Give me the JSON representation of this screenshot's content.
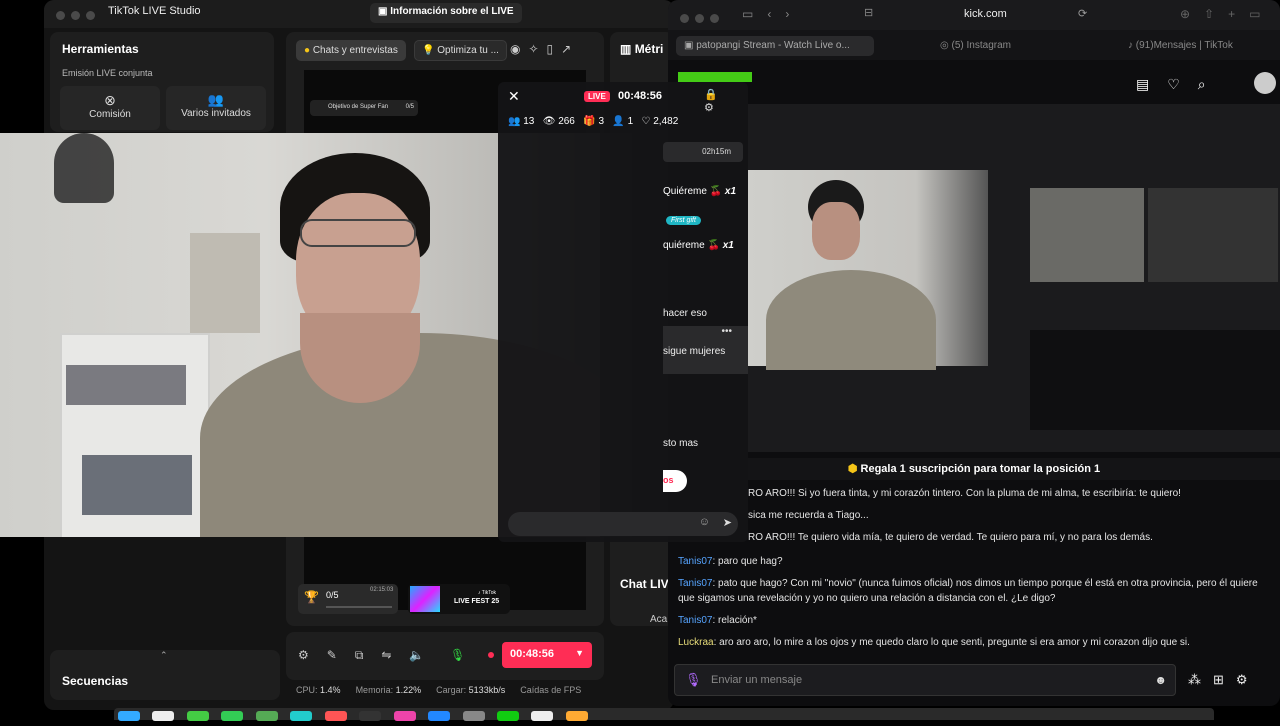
{
  "studio": {
    "title": "TikTok LIVE Studio",
    "info_button": "Información sobre el LIVE",
    "tools_title": "Herramientas",
    "emision_label": "Emisión LIVE conjunta",
    "comision": "Comisión",
    "varios": "Varios invitados",
    "tab_chats": "Chats y entrevistas",
    "tab_optimiza": "Optimiza tu ...",
    "metricas": "Métri",
    "super_fan": "Objetivo de Super Fan",
    "super_fan_count": "0/5",
    "goal_count": "0/5",
    "goal_time": "02:15:03",
    "livefest_brand": "♪ TikTok",
    "livefest": "LIVE FEST 25",
    "chat_live": "Chat LIV",
    "aca": "Aca",
    "secuencias": "Secuencias",
    "cpu_label": "CPU:",
    "cpu": "1.4%",
    "mem_label": "Memoria:",
    "mem": "1.22%",
    "load_label": "Cargar:",
    "load": "5133kb/s",
    "fps_label": "Caídas de FPS",
    "timer": "00:48:56"
  },
  "overlay": {
    "live_badge": "LIVE",
    "timer": "00:48:56",
    "viewers": "13",
    "views": "266",
    "gifts": "3",
    "followers": "1",
    "likes": "2,482",
    "time_left": "02h15m",
    "gift1": "Quiéreme",
    "gift1_x": "x1",
    "first_gift": "First gift",
    "gift2": "quiéreme",
    "gift2_x": "x1",
    "msg1": "hacer eso",
    "msg2": "sigue mujeres",
    "msg3": "sto mas",
    "msg4": "os"
  },
  "kick": {
    "url": "kick.com",
    "tab1": "patopangi Stream - Watch Live o...",
    "tab2": "(5) Instagram",
    "tab3": "(91)Mensajes | TikTok",
    "pinned": "Regala 1 suscripción para tomar la posición 1",
    "messages": [
      {
        "user": "",
        "text": "RO ARO!!! Si yo fuera tinta, y mi corazón tintero. Con la pluma de mi alma, te escribiría: te quiero!"
      },
      {
        "user": "",
        "text": "sica me recuerda a Tiago..."
      },
      {
        "user": "",
        "text": "RO ARO!!! Te quiero vida mía, te quiero de verdad. Te quiero para mí, y no para los demás."
      },
      {
        "user": "Tanis07",
        "text": ": paro que hag?"
      },
      {
        "user": "Tanis07",
        "text": ": pato que hago? Con mi \"novio\" (nunca fuimos oficial) nos dimos un tiempo porque él está en otra provincia, pero él quiere que sigamos una revelación y yo no quiero una relación a distancia con el. ¿Le digo?"
      },
      {
        "user": "Tanis07",
        "text": ": relación*"
      },
      {
        "user": "Luckraa",
        "text": ": aro aro aro, lo mire a los ojos y me quedo claro lo que senti, pregunte si era amor y mi corazon dijo que si."
      }
    ],
    "input_placeholder": "Enviar un mensaje"
  }
}
